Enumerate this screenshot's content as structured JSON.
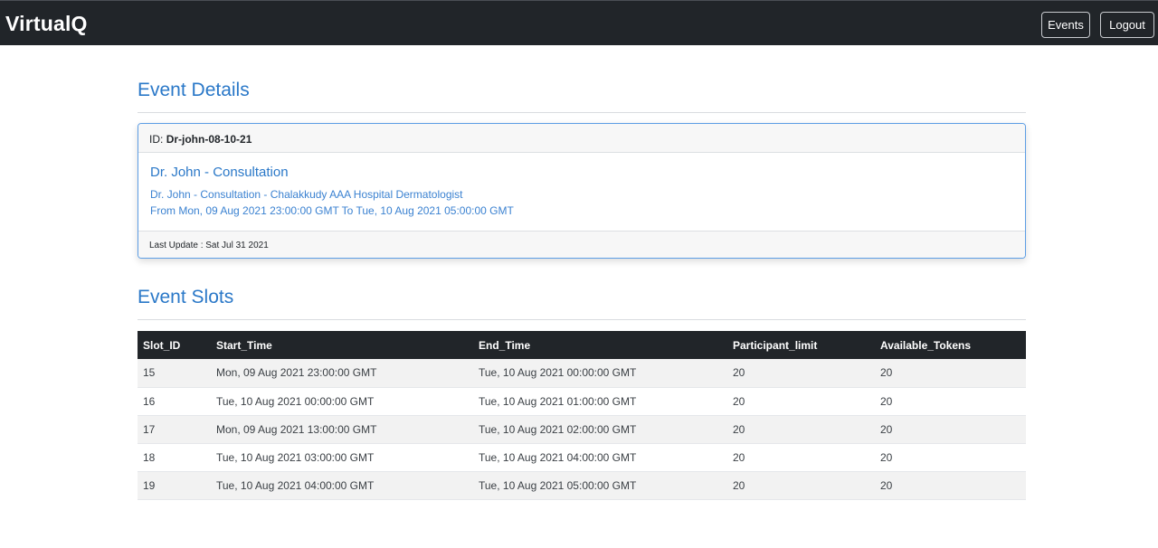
{
  "navbar": {
    "brand": "VirtualQ",
    "events_label": "Events",
    "logout_label": "Logout"
  },
  "event_details": {
    "section_title": "Event Details",
    "id_label": "ID:",
    "id_value": "Dr-john-08-10-21",
    "title": "Dr. John - Consultation",
    "description": "Dr. John - Consultation - Chalakkudy AAA Hospital Dermatologist",
    "time_range": "From Mon, 09 Aug 2021 23:00:00 GMT To Tue, 10 Aug 2021 05:00:00 GMT",
    "last_update": "Last Update : Sat Jul 31 2021"
  },
  "event_slots": {
    "section_title": "Event Slots",
    "columns": [
      "Slot_ID",
      "Start_Time",
      "End_Time",
      "Participant_limit",
      "Available_Tokens"
    ],
    "rows": [
      [
        "15",
        "Mon, 09 Aug 2021 23:00:00 GMT",
        "Tue, 10 Aug 2021 00:00:00 GMT",
        "20",
        "20"
      ],
      [
        "16",
        "Tue, 10 Aug 2021 00:00:00 GMT",
        "Tue, 10 Aug 2021 01:00:00 GMT",
        "20",
        "20"
      ],
      [
        "17",
        "Mon, 09 Aug 2021 13:00:00 GMT",
        "Tue, 10 Aug 2021 02:00:00 GMT",
        "20",
        "20"
      ],
      [
        "18",
        "Tue, 10 Aug 2021 03:00:00 GMT",
        "Tue, 10 Aug 2021 04:00:00 GMT",
        "20",
        "20"
      ],
      [
        "19",
        "Tue, 10 Aug 2021 04:00:00 GMT",
        "Tue, 10 Aug 2021 05:00:00 GMT",
        "20",
        "20"
      ]
    ]
  },
  "colors": {
    "navbar_bg": "#212529",
    "accent": "#2a78c8",
    "card_border": "#5d9ee5"
  }
}
